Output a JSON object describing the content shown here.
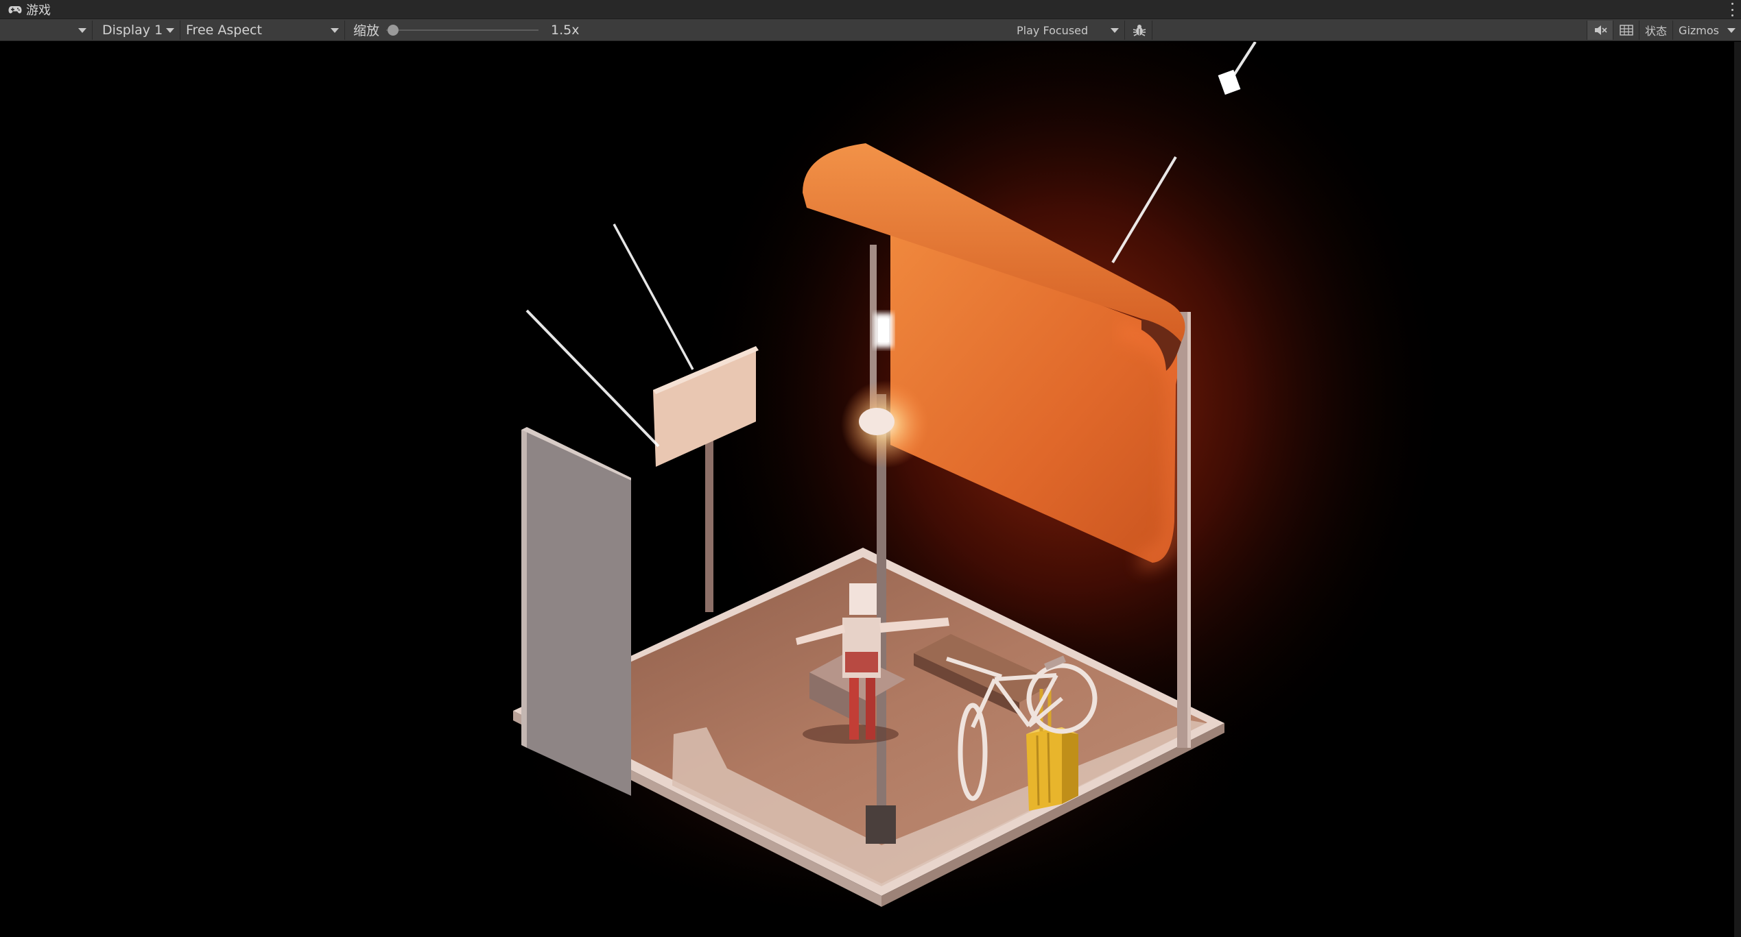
{
  "window": {
    "tab_title": "游戏",
    "tab_icon": "gamepad-icon"
  },
  "toolbar": {
    "target_dropdown": "",
    "display": "Display 1",
    "aspect": "Free Aspect",
    "scale_label": "缩放",
    "scale_value": "1.5x",
    "scale_fraction": 0.0,
    "play_mode": "Play Focused",
    "stats_label": "状态",
    "gizmos_label": "Gizmos"
  },
  "icons": {
    "mute": "mute-audio-icon",
    "grid": "grid-icon",
    "bug": "bug-icon",
    "more": "kebab-menu-icon"
  },
  "colors": {
    "panel_bg": "#282828",
    "toolbar_bg": "#3c3c3c",
    "accent_orange": "#e8742e",
    "glow_red": "#8a1a08"
  }
}
